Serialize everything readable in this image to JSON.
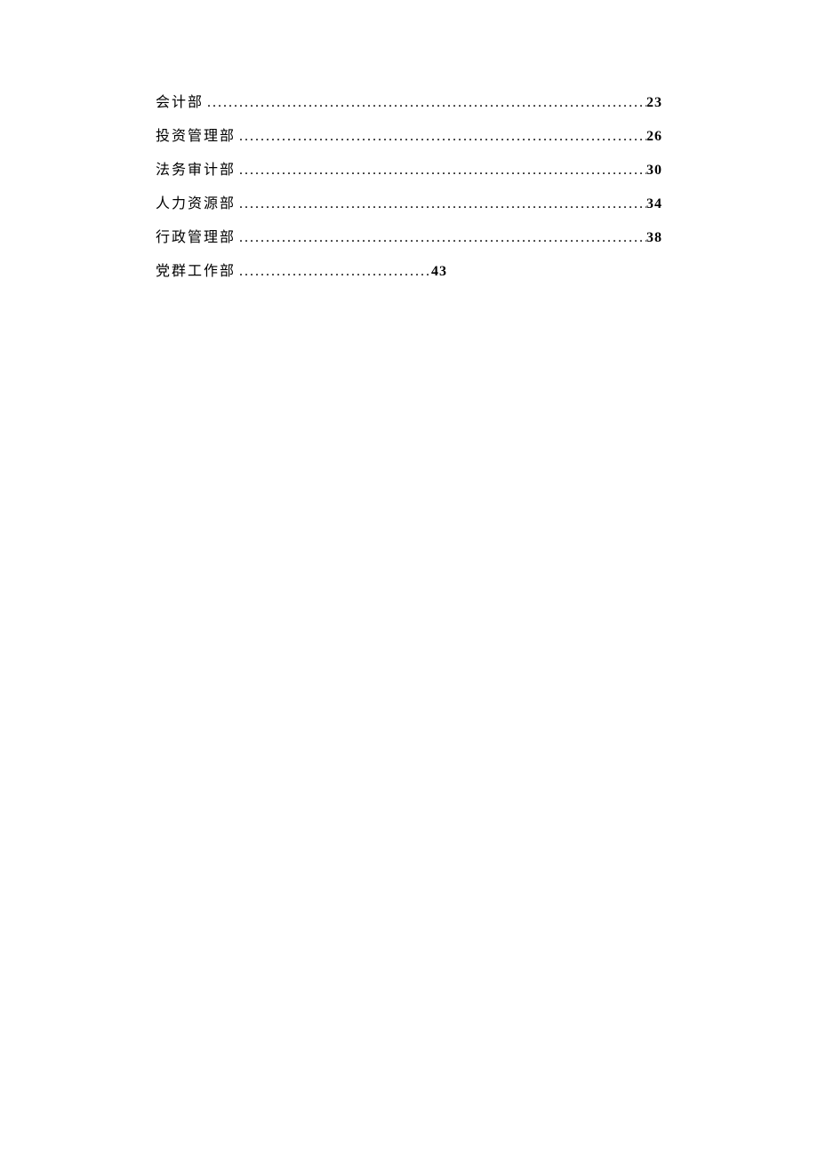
{
  "toc": {
    "entries": [
      {
        "title": "会计部",
        "page": "23",
        "short": false
      },
      {
        "title": "投资管理部",
        "page": "26",
        "short": false
      },
      {
        "title": "法务审计部",
        "page": "30",
        "short": false
      },
      {
        "title": "人力资源部",
        "page": "34",
        "short": false
      },
      {
        "title": "行政管理部",
        "page": "38",
        "short": false
      },
      {
        "title": "党群工作部",
        "page": "43",
        "short": true
      }
    ]
  }
}
